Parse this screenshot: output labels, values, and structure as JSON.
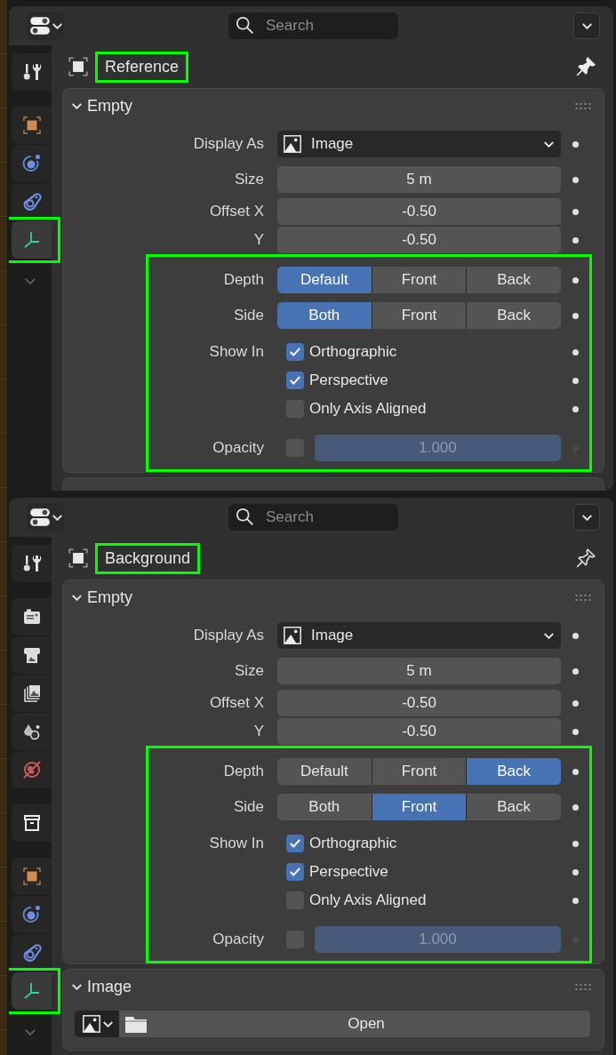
{
  "panels": [
    {
      "search": {
        "placeholder": "Search"
      },
      "sidebar_groups": [
        [
          {
            "kind": "tool",
            "selected": false,
            "highlighted": false
          }
        ],
        [
          {
            "kind": "object",
            "selected": false,
            "highlighted": false
          },
          {
            "kind": "physics",
            "selected": false,
            "highlighted": false
          },
          {
            "kind": "constraints",
            "selected": false,
            "highlighted": false
          },
          {
            "kind": "data",
            "selected": true,
            "highlighted": true
          }
        ]
      ],
      "object": {
        "name": "Reference",
        "highlighted": true
      },
      "pinned": true,
      "sections": [
        {
          "kind": "empty",
          "title": "Empty",
          "display_as": {
            "label": "Display As",
            "value": "Image"
          },
          "size": {
            "label": "Size",
            "value": "5 m"
          },
          "offset_x": {
            "label": "Offset X",
            "value": "-0.50"
          },
          "offset_y": {
            "label": "Y",
            "value": "-0.50"
          },
          "view_settings": {
            "highlighted": true,
            "depth": {
              "label": "Depth",
              "options": [
                {
                  "label": "Default",
                  "selected": true
                },
                {
                  "label": "Front",
                  "selected": false
                },
                {
                  "label": "Back",
                  "selected": false
                }
              ]
            },
            "side": {
              "label": "Side",
              "options": [
                {
                  "label": "Both",
                  "selected": true
                },
                {
                  "label": "Front",
                  "selected": false
                },
                {
                  "label": "Back",
                  "selected": false
                }
              ]
            },
            "show_in": {
              "label": "Show In",
              "options": [
                {
                  "label": "Orthographic",
                  "checked": true
                },
                {
                  "label": "Perspective",
                  "checked": true
                },
                {
                  "label": "Only Axis Aligned",
                  "checked": false
                }
              ]
            },
            "opacity": {
              "label": "Opacity",
              "checked": false,
              "value": "1.000"
            }
          }
        },
        {
          "kind": "blank"
        }
      ]
    },
    {
      "search": {
        "placeholder": "Search"
      },
      "sidebar_groups": [
        [
          {
            "kind": "tool",
            "selected": false,
            "highlighted": false
          }
        ],
        [
          {
            "kind": "render",
            "selected": false,
            "highlighted": false
          },
          {
            "kind": "output",
            "selected": false,
            "highlighted": false
          },
          {
            "kind": "view_layer",
            "selected": false,
            "highlighted": false
          },
          {
            "kind": "scene",
            "selected": false,
            "highlighted": false
          },
          {
            "kind": "world",
            "selected": false,
            "highlighted": false
          }
        ],
        [
          {
            "kind": "collection",
            "selected": false,
            "highlighted": false
          }
        ],
        [
          {
            "kind": "object",
            "selected": false,
            "highlighted": false
          },
          {
            "kind": "physics",
            "selected": false,
            "highlighted": false
          },
          {
            "kind": "constraints",
            "selected": false,
            "highlighted": false
          },
          {
            "kind": "data",
            "selected": true,
            "highlighted": true
          }
        ]
      ],
      "object": {
        "name": "Background",
        "highlighted": true
      },
      "pinned": false,
      "sections": [
        {
          "kind": "empty",
          "title": "Empty",
          "display_as": {
            "label": "Display As",
            "value": "Image"
          },
          "size": {
            "label": "Size",
            "value": "5 m"
          },
          "offset_x": {
            "label": "Offset X",
            "value": "-0.50"
          },
          "offset_y": {
            "label": "Y",
            "value": "-0.50"
          },
          "view_settings": {
            "highlighted": true,
            "depth": {
              "label": "Depth",
              "options": [
                {
                  "label": "Default",
                  "selected": false
                },
                {
                  "label": "Front",
                  "selected": false
                },
                {
                  "label": "Back",
                  "selected": true
                }
              ]
            },
            "side": {
              "label": "Side",
              "options": [
                {
                  "label": "Both",
                  "selected": false
                },
                {
                  "label": "Front",
                  "selected": true
                },
                {
                  "label": "Back",
                  "selected": false
                }
              ]
            },
            "show_in": {
              "label": "Show In",
              "options": [
                {
                  "label": "Orthographic",
                  "checked": true
                },
                {
                  "label": "Perspective",
                  "checked": true
                },
                {
                  "label": "Only Axis Aligned",
                  "checked": false
                }
              ]
            },
            "opacity": {
              "label": "Opacity",
              "checked": false,
              "value": "1.000"
            }
          }
        },
        {
          "kind": "image",
          "title": "Image",
          "button": "Open"
        }
      ]
    }
  ]
}
